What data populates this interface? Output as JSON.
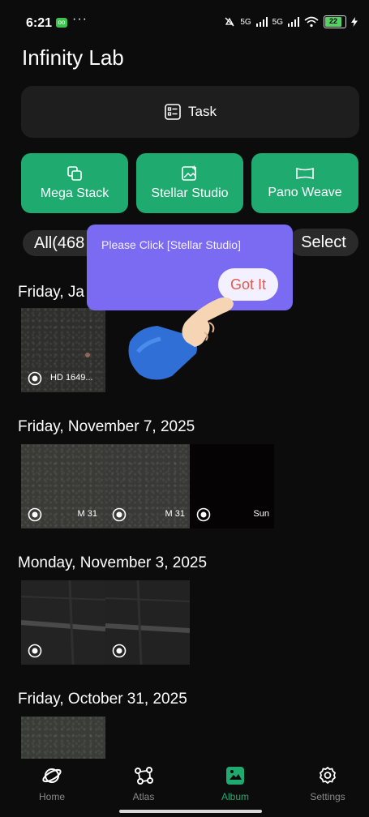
{
  "status_bar": {
    "time": "6:21",
    "app_badge": "oo",
    "dots": "···",
    "signal_1": "5G",
    "signal_2": "5G",
    "battery_level": "22"
  },
  "header": {
    "title": "Infinity Lab"
  },
  "task_button": {
    "label": "Task",
    "icon": "task-list-icon"
  },
  "feature_buttons": [
    {
      "label": "Mega Stack",
      "icon": "stack-icon"
    },
    {
      "label": "Stellar Studio",
      "icon": "image-edit-icon"
    },
    {
      "label": "Pano Weave",
      "icon": "panorama-icon"
    }
  ],
  "filter": {
    "all_label": "All(468",
    "select_label": "Select"
  },
  "tooltip": {
    "text": "Please Click [Stellar Studio]",
    "button_label": "Got It"
  },
  "sections": [
    {
      "date": "Friday, Ja",
      "photos": [
        {
          "label": "HD 1649..."
        }
      ]
    },
    {
      "date": "Friday, November 7, 2025",
      "photos": [
        {
          "label": "M 31"
        },
        {
          "label": "M 31"
        },
        {
          "label": "Sun"
        }
      ]
    },
    {
      "date": "Monday, November 3, 2025",
      "photos": [
        {
          "label": ""
        },
        {
          "label": ""
        }
      ]
    },
    {
      "date": "Friday, October 31, 2025",
      "photos": [
        {
          "label": ""
        }
      ]
    }
  ],
  "bottom_nav": [
    {
      "label": "Home",
      "icon": "planet-icon",
      "active": false
    },
    {
      "label": "Atlas",
      "icon": "constellation-icon",
      "active": false
    },
    {
      "label": "Album",
      "icon": "album-image-icon",
      "active": true
    },
    {
      "label": "Settings",
      "icon": "gear-icon",
      "active": false
    }
  ],
  "colors": {
    "accent_green": "#1faa70",
    "tooltip_purple": "#7a6bf2",
    "got_it_red": "#e6574e",
    "background": "#0c0c0c"
  }
}
